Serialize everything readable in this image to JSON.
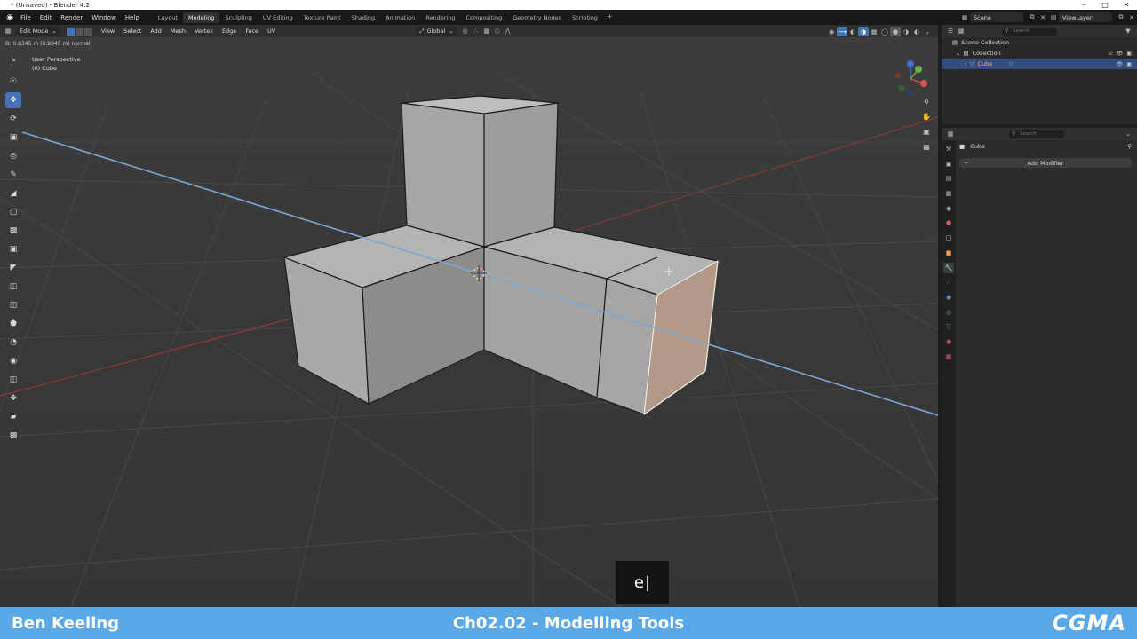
{
  "window": {
    "title": "* (Unsaved) - Blender 4.2"
  },
  "menu": {
    "items": [
      "File",
      "Edit",
      "Render",
      "Window",
      "Help"
    ]
  },
  "workspaces": {
    "tabs": [
      "Layout",
      "Modeling",
      "Sculpting",
      "UV Editing",
      "Texture Paint",
      "Shading",
      "Animation",
      "Rendering",
      "Compositing",
      "Geometry Nodes",
      "Scripting"
    ],
    "active": "Modeling"
  },
  "scene": {
    "scene_name": "Scene",
    "view_layer": "ViewLayer"
  },
  "viewport_header": {
    "mode": "Edit Mode",
    "menus": [
      "View",
      "Select",
      "Add",
      "Mesh",
      "Vertex",
      "Edge",
      "Face",
      "UV"
    ],
    "orientation": "Global"
  },
  "viewport": {
    "status_line": "D: 0.8345 m (0.8345 m) normal",
    "view_name": "User Perspective",
    "object_label": "(0) Cube"
  },
  "outliner": {
    "search_placeholder": "Search",
    "root": "Scene Collection",
    "collection": "Collection",
    "object": "Cube"
  },
  "properties": {
    "search_placeholder": "Search",
    "object_name": "Cube",
    "add_modifier_label": "Add Modifier"
  },
  "keycast": {
    "key": "e"
  },
  "footer": {
    "author": "Ben Keeling",
    "chapter": "Ch02.02 - Modelling Tools",
    "brand": "CGMA"
  },
  "colors": {
    "accent": "#4772b3",
    "footer_bg": "#5aa9e6",
    "viewport_bg": "#3a3a3a",
    "selected_face": "#b39a88"
  }
}
